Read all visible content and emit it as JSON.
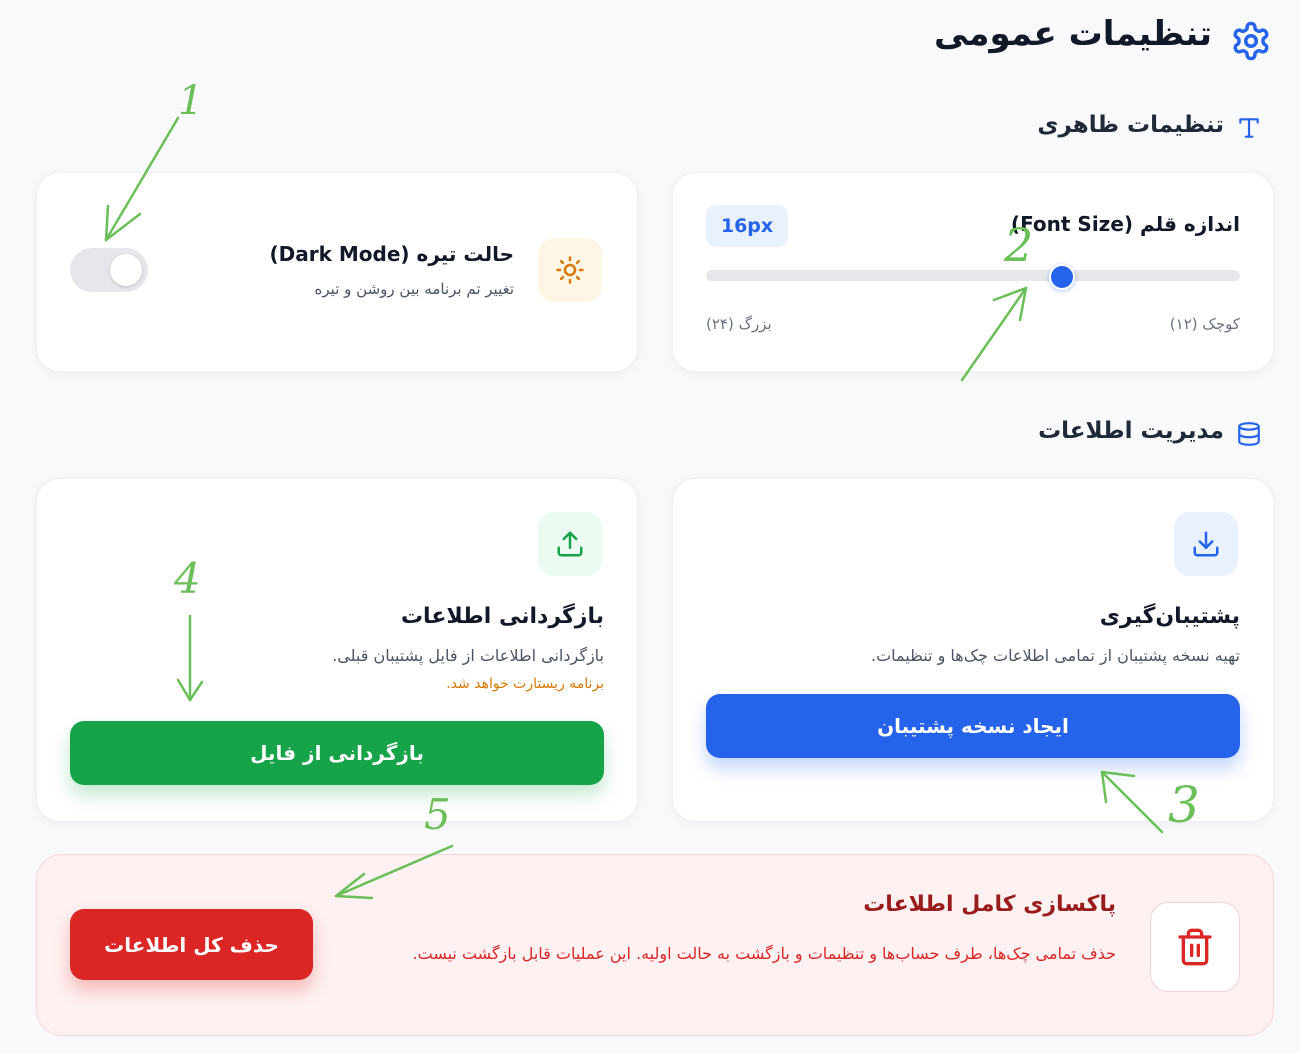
{
  "header": {
    "title": "تنظیمات عمومی",
    "icon": "gear-icon"
  },
  "appearance": {
    "section_title": "تنظیمات ظاهری",
    "section_icon": "type-icon",
    "font_size": {
      "label": "اندازه قلم (Font Size)",
      "value_badge": "16px",
      "min_label": "کوچک (۱۲)",
      "max_label": "بزرگ (۲۴)",
      "min": 12,
      "max": 24,
      "value": 16
    },
    "dark_mode": {
      "title": "حالت تیره (Dark Mode)",
      "description": "تغییر تم برنامه بین روشن و تیره",
      "enabled": false,
      "icon": "sun-icon"
    }
  },
  "data_management": {
    "section_title": "مدیریت اطلاعات",
    "section_icon": "database-icon",
    "backup": {
      "title": "پشتیبان‌گیری",
      "description": "تهیه نسخه پشتیبان از تمامی اطلاعات چک‌ها و تنظیمات.",
      "button_label": "ایجاد نسخه پشتیبان",
      "icon": "download-icon"
    },
    "restore": {
      "title": "بازگردانی اطلاعات",
      "description": "بازگردانی اطلاعات از فایل پشتیبان قبلی.",
      "warning": "برنامه ریستارت خواهد شد.",
      "button_label": "بازگردانی از فایل",
      "icon": "upload-icon"
    }
  },
  "danger_zone": {
    "title": "پاکسازی کامل اطلاعات",
    "description": "حذف تمامی چک‌ها، طرف حساب‌ها و تنظیمات و بازگشت به حالت اولیه. این عملیات قابل بازگشت نیست.",
    "button_label": "حذف کل اطلاعات",
    "icon": "trash-icon"
  },
  "annotations": [
    "1",
    "2",
    "3",
    "4",
    "5"
  ],
  "colors": {
    "primary": "#2563eb",
    "success": "#16a34a",
    "danger": "#dc2626",
    "warning": "#d97706",
    "annotation": "#6bbf59"
  }
}
